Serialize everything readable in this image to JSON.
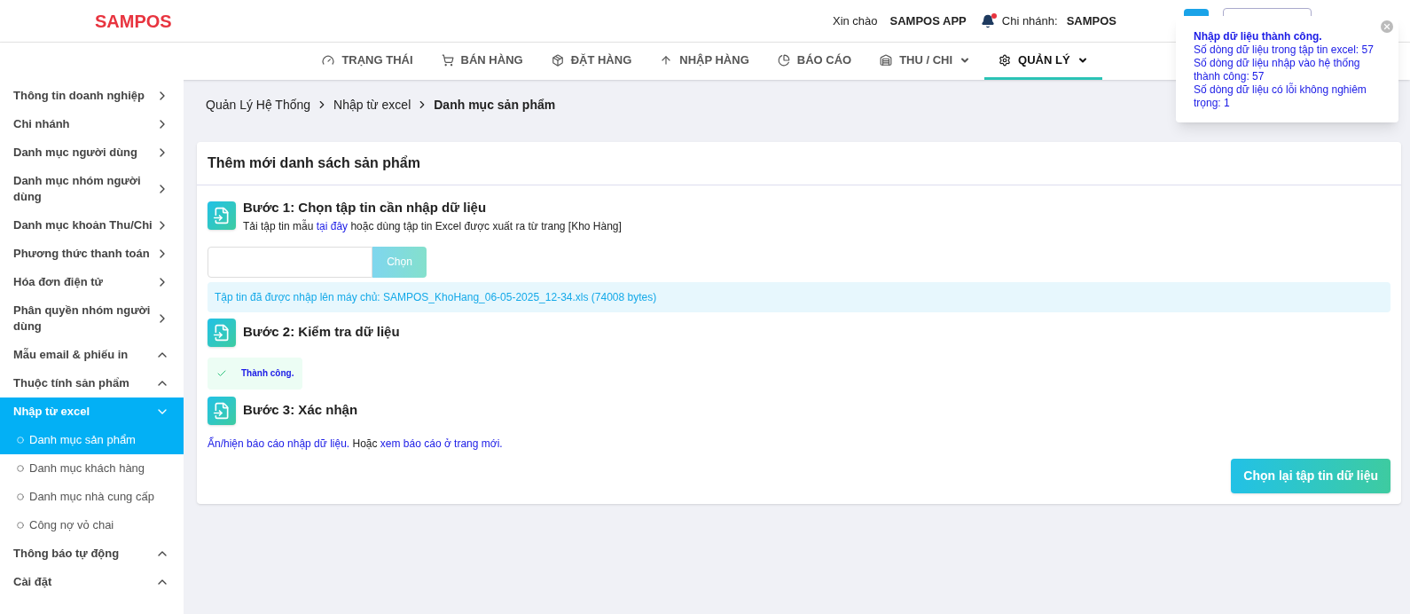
{
  "header": {
    "logo": "SAMPOS",
    "greeting": "Xin chào",
    "user": "SAMPOS APP",
    "notification_dot": true,
    "branch_label": "Chi nhánh:",
    "branch": "SAMPOS"
  },
  "nav": [
    {
      "label": "TRẠNG THÁI",
      "dropdown": false,
      "selected": false
    },
    {
      "label": "BÁN HÀNG",
      "dropdown": false,
      "selected": false
    },
    {
      "label": "ĐẶT HÀNG",
      "dropdown": false,
      "selected": false
    },
    {
      "label": "NHẬP HÀNG",
      "dropdown": false,
      "selected": false
    },
    {
      "label": "BÁO CÁO",
      "dropdown": false,
      "selected": false
    },
    {
      "label": "THU / CHI",
      "dropdown": true,
      "selected": false
    },
    {
      "label": "QUẢN LÝ",
      "dropdown": true,
      "selected": true
    }
  ],
  "sidebar": {
    "items": [
      {
        "label": "Thông tin doanh nghiệp",
        "kind": "link",
        "selected": false
      },
      {
        "label": "Chi nhánh",
        "kind": "link",
        "selected": false
      },
      {
        "label": "Danh mục người dùng",
        "kind": "link",
        "selected": false
      },
      {
        "label": "Danh mục nhóm người dùng",
        "kind": "link",
        "selected": false
      },
      {
        "label": "Danh mục khoản Thu/Chi",
        "kind": "link",
        "selected": false
      },
      {
        "label": "Phương thức thanh toán",
        "kind": "link",
        "selected": false
      },
      {
        "label": "Hóa đơn điện tử",
        "kind": "link",
        "selected": false
      },
      {
        "label": "Phân quyền nhóm người dùng",
        "kind": "link",
        "selected": false
      },
      {
        "label": "Mẫu email & phiếu in",
        "kind": "group",
        "expanded": false,
        "selected": false
      },
      {
        "label": "Thuộc tính sản phẩm",
        "kind": "group",
        "expanded": false,
        "selected": false
      },
      {
        "label": "Nhập từ excel",
        "kind": "group",
        "expanded": true,
        "selected": true,
        "children": [
          {
            "label": "Danh mục sản phẩm",
            "selected": true
          },
          {
            "label": "Danh mục khách hàng",
            "selected": false
          },
          {
            "label": "Danh mục nhà cung cấp",
            "selected": false
          },
          {
            "label": "Công nợ vỏ chai",
            "selected": false
          }
        ]
      },
      {
        "label": "Thông báo tự động",
        "kind": "group",
        "expanded": false,
        "selected": false
      },
      {
        "label": "Cài đặt",
        "kind": "group",
        "expanded": false,
        "selected": false
      }
    ]
  },
  "breadcrumb": [
    "Quản Lý Hệ Thống",
    "Nhập từ excel",
    "Danh mục sản phẩm"
  ],
  "card": {
    "title": "Thêm mới danh sách sản phẩm",
    "step1": {
      "title": "Bước 1: Chọn tập tin cần nhập dữ liệu",
      "hint_before": "Tải tập tin mẫu",
      "hint_link": "tại đây",
      "hint_after": "hoặc dùng tập tin Excel được xuất ra từ trang [Kho Hàng]",
      "choose_button": "Chọn",
      "uploaded": "Tập tin đã được nhập lên máy chủ: SAMPOS_KhoHang_06-05-2025_12-34.xls (74008 bytes)"
    },
    "step2": {
      "title": "Bước 2: Kiểm tra dữ liệu",
      "result": "Thành công."
    },
    "step3": {
      "title": "Bước 3: Xác nhận",
      "toggle_link": "Ẩn/hiện báo cáo nhập dữ liệu.",
      "or": "Hoặc",
      "new_page_link": "xem báo cáo ở trang mới."
    },
    "reselect_button": "Chọn lại tập tin dữ liệu"
  },
  "toast": {
    "title": "Nhập dữ liệu thành công.",
    "lines": [
      "Số dòng dữ liệu trong tập tin excel: 57",
      "Số dòng dữ liệu nhập vào hệ thống thành công: 57",
      "Số dòng dữ liệu có lỗi không nghiêm trọng: 1"
    ]
  }
}
